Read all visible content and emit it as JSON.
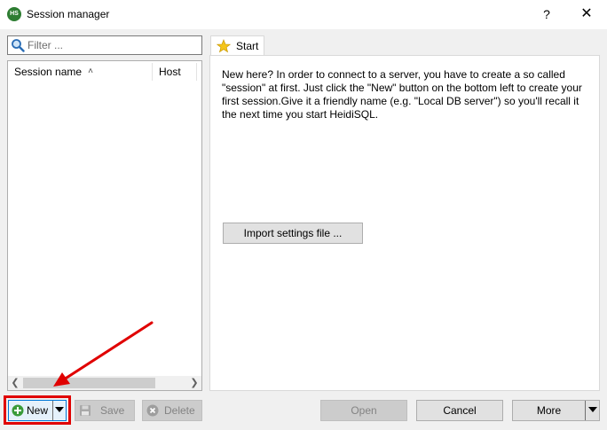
{
  "window": {
    "title": "Session manager",
    "logo_text": "HS",
    "help_label": "?",
    "close_label": "✕"
  },
  "filter": {
    "placeholder": "Filter ...",
    "value": ""
  },
  "session_list": {
    "columns": [
      {
        "label": "Session name",
        "sorted": "ascending"
      },
      {
        "label": "Host"
      }
    ],
    "rows": []
  },
  "tabs": [
    {
      "label": "Start",
      "icon": "star-icon",
      "active": true
    }
  ],
  "start_page": {
    "intro_text": "New here? In order to connect to a server, you have to create a so called \"session\" at first. Just click the \"New\" button on the bottom left to create your first session.Give it a friendly name (e.g. \"Local DB server\") so you'll recall it the next time you start HeidiSQL.",
    "import_button_label": "Import settings file ..."
  },
  "buttons": {
    "new_label": "New",
    "save_label": "Save",
    "delete_label": "Delete",
    "open_label": "Open",
    "cancel_label": "Cancel",
    "more_label": "More"
  },
  "colors": {
    "highlight": "#e00000",
    "accent": "#0078d7",
    "new_icon": "#3a9b3a"
  }
}
